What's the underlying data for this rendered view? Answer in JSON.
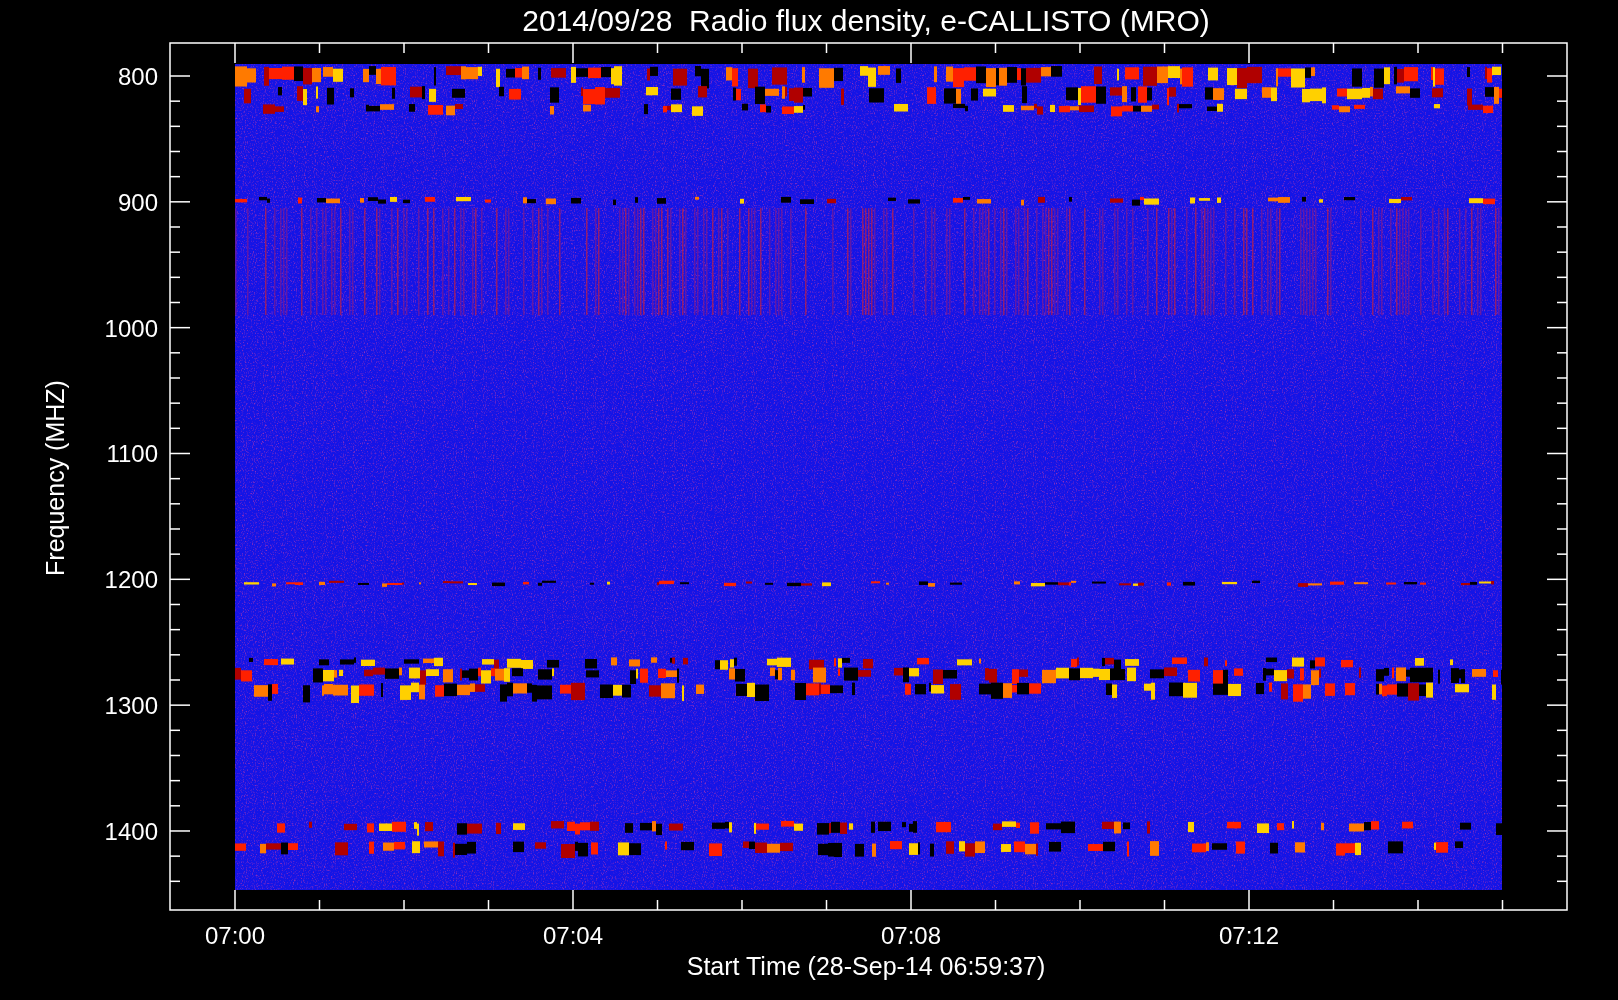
{
  "title": "2014/09/28  Radio flux density, e-CALLISTO (MRO)",
  "plot": {
    "xlabel": "Start Time (28-Sep-14 06:59:37)",
    "ylabel": "Frequency (MHZ)",
    "xticks": [
      "07:00",
      "07:04",
      "07:08",
      "07:12"
    ],
    "yticks": [
      "800",
      "900",
      "1000",
      "1100",
      "1200",
      "1300",
      "1400"
    ]
  }
}
